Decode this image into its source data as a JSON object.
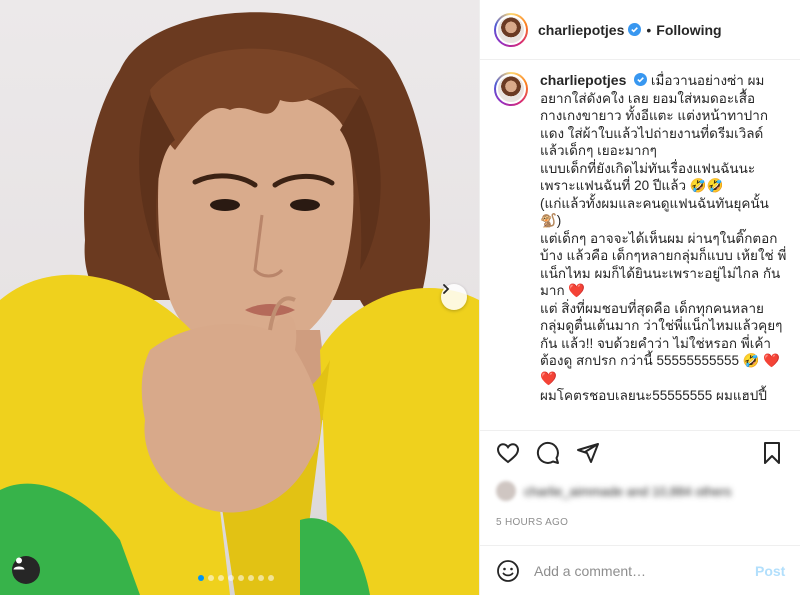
{
  "post": {
    "username": "charliepotjes",
    "follow_status": "Following",
    "separator": "•"
  },
  "caption": {
    "username": "charliepotjes",
    "lines": [
      "เมื่อวานอย่างซ่า ผม อยากใส่ดังคใง เลย ยอมใส่หมดอะเสื้อ กางเกงขายาว ทั้งอีแตะ แต่งหน้าทาปาก แดง ใส่ผ้าใบแล้วไปถ่ายงานที่ดรีมเวิลด์ แล้วเด็กๆ เยอะมากๆ",
      "แบบเด็กที่ยังเกิดไม่ทันเรื่องแฟนฉันนะ เพราะแฟนฉันที่ 20 ปีแล้ว 🤣🤣",
      "(แก่แล้วทั้งผมและคนดูแฟนฉันทันยุคนั้น 🐒)",
      "แต่เด็กๆ อาจจะได้เห็นผม ผ่านๆในติ๊กตอก บ้าง แล้วคือ เด็กๆหลายกลุ่มก็แบบ เห้ยใช่ พี่แน็กไหม ผมก็ได้ยินนะเพราะอยู่ไม่ไกล กันมาก ❤️",
      "แต่ สิ่งที่ผมชอบที่สุดคือ เด็กทุกคนหลาย กลุ่มดูตื่นเต้นมาก ว่าใช่พี่แน็กไหมแล้วคุยๆ กัน แล้ว!! จบด้วยคำว่า ไม่ใช่หรอก พี่เค้า ต้องดู สกปรก กว่านี้ 55555555555 🤣 ❤️❤️",
      "ผมโคตรชอบเลยนะ55555555 ผมแฮปปี้"
    ]
  },
  "likes": {
    "text": "charlie_aimmade and 10,884 others"
  },
  "timestamp": "5 HOURS AGO",
  "comment": {
    "placeholder": "Add a comment…",
    "post_label": "Post"
  },
  "carousel": {
    "total": 8,
    "active": 0
  },
  "colors": {
    "accent": "#0095f6",
    "verified": "#3897f0",
    "post_disabled": "#b2dffc",
    "shirt": "#f0d21f"
  },
  "icons": [
    "heart-icon",
    "comment-icon",
    "share-icon",
    "bookmark-icon",
    "smiley-icon",
    "chevron-right-icon",
    "user-tag-icon",
    "verified-icon"
  ]
}
